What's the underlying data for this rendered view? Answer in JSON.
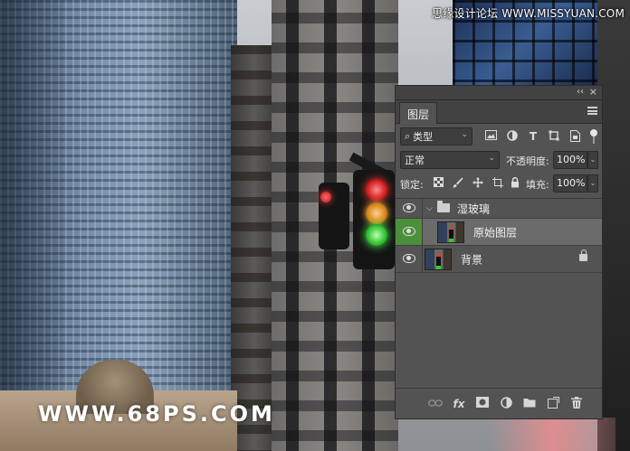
{
  "watermarks": {
    "top": "思缘设计论坛 WWW.MISSYUAN.COM",
    "bottom": "WWW.68PS.COM"
  },
  "layers_panel": {
    "topbar": {
      "collapse_glyph": "‹‹",
      "close_glyph": "×"
    },
    "tab_label": "图层",
    "filter": {
      "search_glyph": "⌕",
      "kind_label": "类型",
      "chevron": "⌄",
      "icons": [
        "image-filter-icon",
        "adjustment-filter-icon",
        "type-filter-icon",
        "shape-filter-icon",
        "smart-object-filter-icon"
      ],
      "type_glyph": "T"
    },
    "blend": {
      "mode": "正常",
      "chevron": "⌄",
      "opacity_label": "不透明度:",
      "opacity_value": "100%",
      "stepper_glyph": "⌄"
    },
    "lock": {
      "label": "锁定:",
      "fill_label": "填充:",
      "fill_value": "100%",
      "stepper_glyph": "⌄"
    },
    "layers": [
      {
        "name": "湿玻璃",
        "type": "group",
        "expanded": true,
        "visible": true,
        "caret": "⌵"
      },
      {
        "name": "原始图层",
        "type": "pixel",
        "selected": true,
        "visible": true
      },
      {
        "name": "背景",
        "type": "background",
        "locked": true,
        "visible": true
      }
    ],
    "bottom_icons": {
      "link": "⊖",
      "fx": "fx",
      "mask": "▣",
      "adjustment": "◐",
      "group": "▭",
      "new_layer": "⊞",
      "delete": "🗑"
    }
  },
  "colors": {
    "panel_bg": "#535353",
    "panel_header": "#424242",
    "field_bg": "#3d3d3d",
    "selected_row": "#6b6b6b",
    "eye_highlight": "#4c8f3a"
  }
}
